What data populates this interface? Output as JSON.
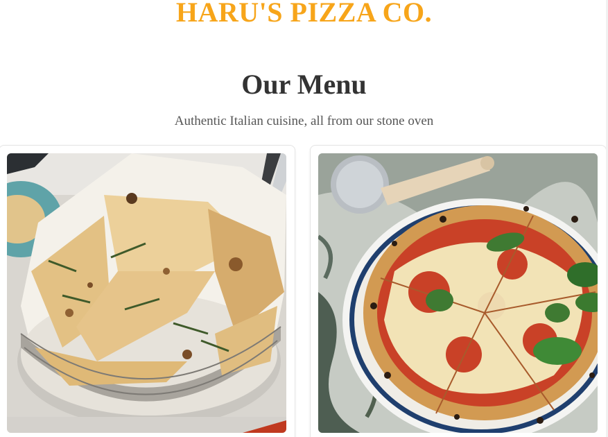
{
  "header": {
    "brand": "HARU'S PIZZA CO."
  },
  "menu": {
    "title": "Our Menu",
    "subtitle": "Authentic Italian cuisine, all from our stone oven"
  },
  "items": [
    {
      "image": "flatbread-basket-photo"
    },
    {
      "image": "margherita-pizza-photo"
    }
  ],
  "colors": {
    "brand": "#f7a51a",
    "heading": "#333333",
    "subtitle": "#555555"
  }
}
